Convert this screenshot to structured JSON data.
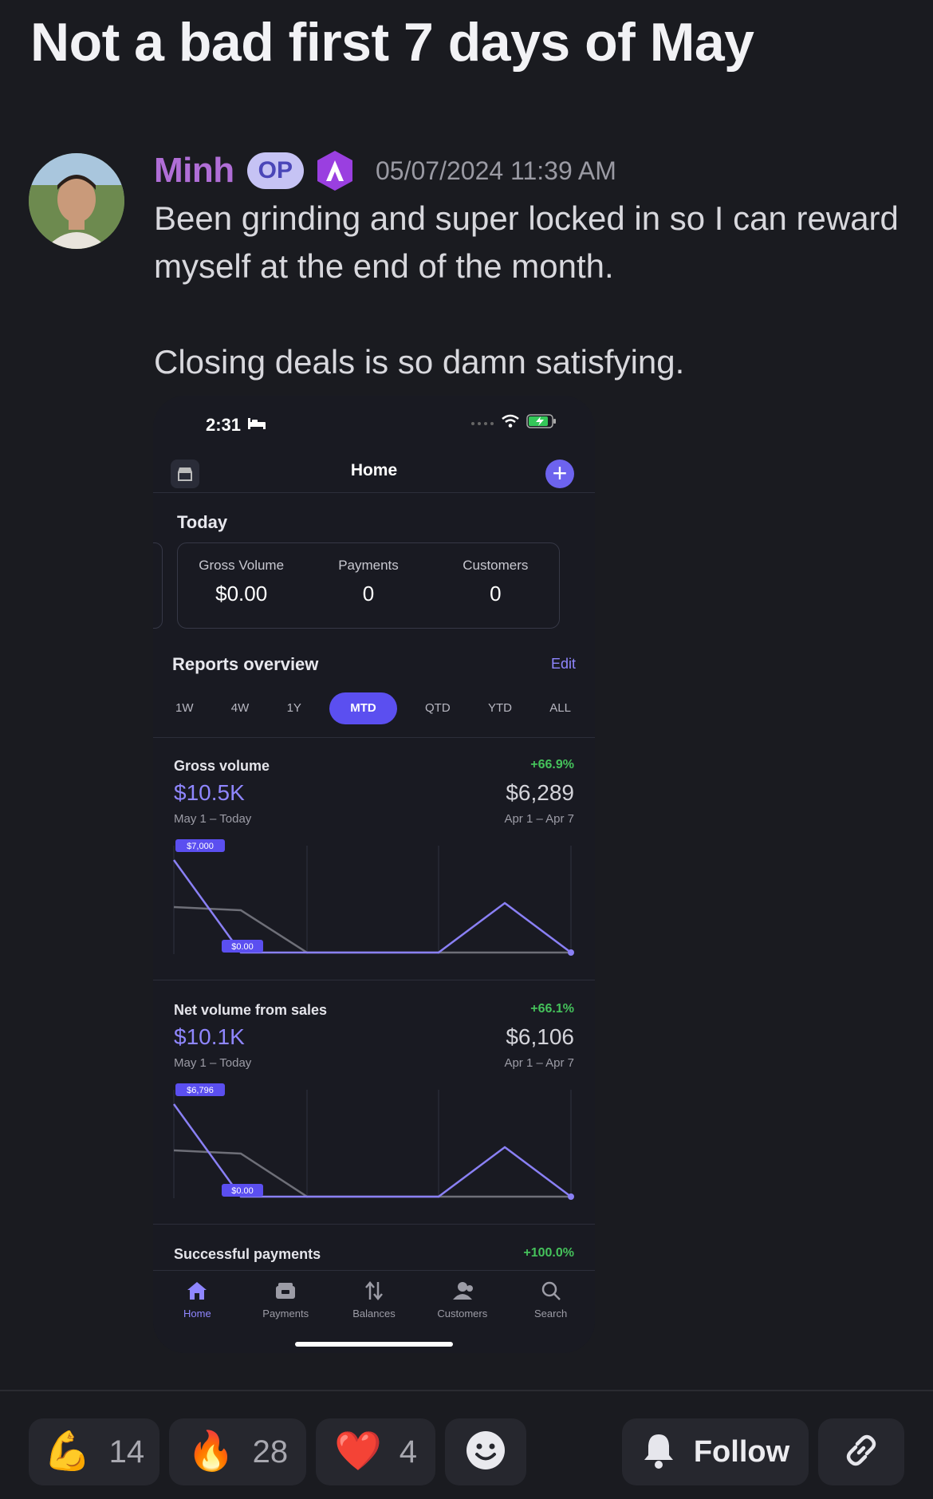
{
  "post": {
    "title": "Not a bad first 7 days of May",
    "author": "Minh",
    "op_badge": "OP",
    "timestamp": "05/07/2024 11:39 AM",
    "body_line1": "Been grinding and super locked in so I can reward",
    "body_line2": "myself at the end of the month.",
    "body_line3": "Closing deals is so damn satisfying."
  },
  "phone": {
    "status_time": "2:31",
    "header_title": "Home",
    "today": {
      "label": "Today",
      "metrics": [
        {
          "label": "Gross Volume",
          "value": "$0.00"
        },
        {
          "label": "Payments",
          "value": "0"
        },
        {
          "label": "Customers",
          "value": "0"
        }
      ]
    },
    "reports": {
      "title": "Reports overview",
      "edit": "Edit",
      "ranges": [
        "1W",
        "4W",
        "1Y",
        "MTD",
        "QTD",
        "YTD",
        "ALL"
      ],
      "active_range": "MTD"
    },
    "gross": {
      "name": "Gross volume",
      "delta": "+66.9%",
      "value": "$10.5K",
      "prev_value": "$6,289",
      "range": "May 1 – Today",
      "prev_range": "Apr 1 – Apr 7",
      "max_label": "$7,000",
      "min_label": "$0.00"
    },
    "net": {
      "name": "Net volume from sales",
      "delta": "+66.1%",
      "value": "$10.1K",
      "prev_value": "$6,106",
      "range": "May 1 – Today",
      "prev_range": "Apr 1 – Apr 7",
      "max_label": "$6,796",
      "min_label": "$0.00"
    },
    "successful": {
      "name": "Successful payments",
      "delta": "+100.0%"
    },
    "tabs": [
      {
        "label": "Home",
        "icon": "home-icon"
      },
      {
        "label": "Payments",
        "icon": "wallet-icon"
      },
      {
        "label": "Balances",
        "icon": "arrows-icon"
      },
      {
        "label": "Customers",
        "icon": "customers-icon"
      },
      {
        "label": "Search",
        "icon": "search-icon"
      }
    ]
  },
  "reactions": [
    {
      "emoji": "💪",
      "count": "14"
    },
    {
      "emoji": "🔥",
      "count": "28"
    },
    {
      "emoji": "❤️",
      "count": "4"
    }
  ],
  "actions": {
    "follow": "Follow"
  },
  "colors": {
    "background": "#1a1b20",
    "author": "#b06ed6",
    "accent": "#6d63ee",
    "positive": "#45c25b"
  }
}
